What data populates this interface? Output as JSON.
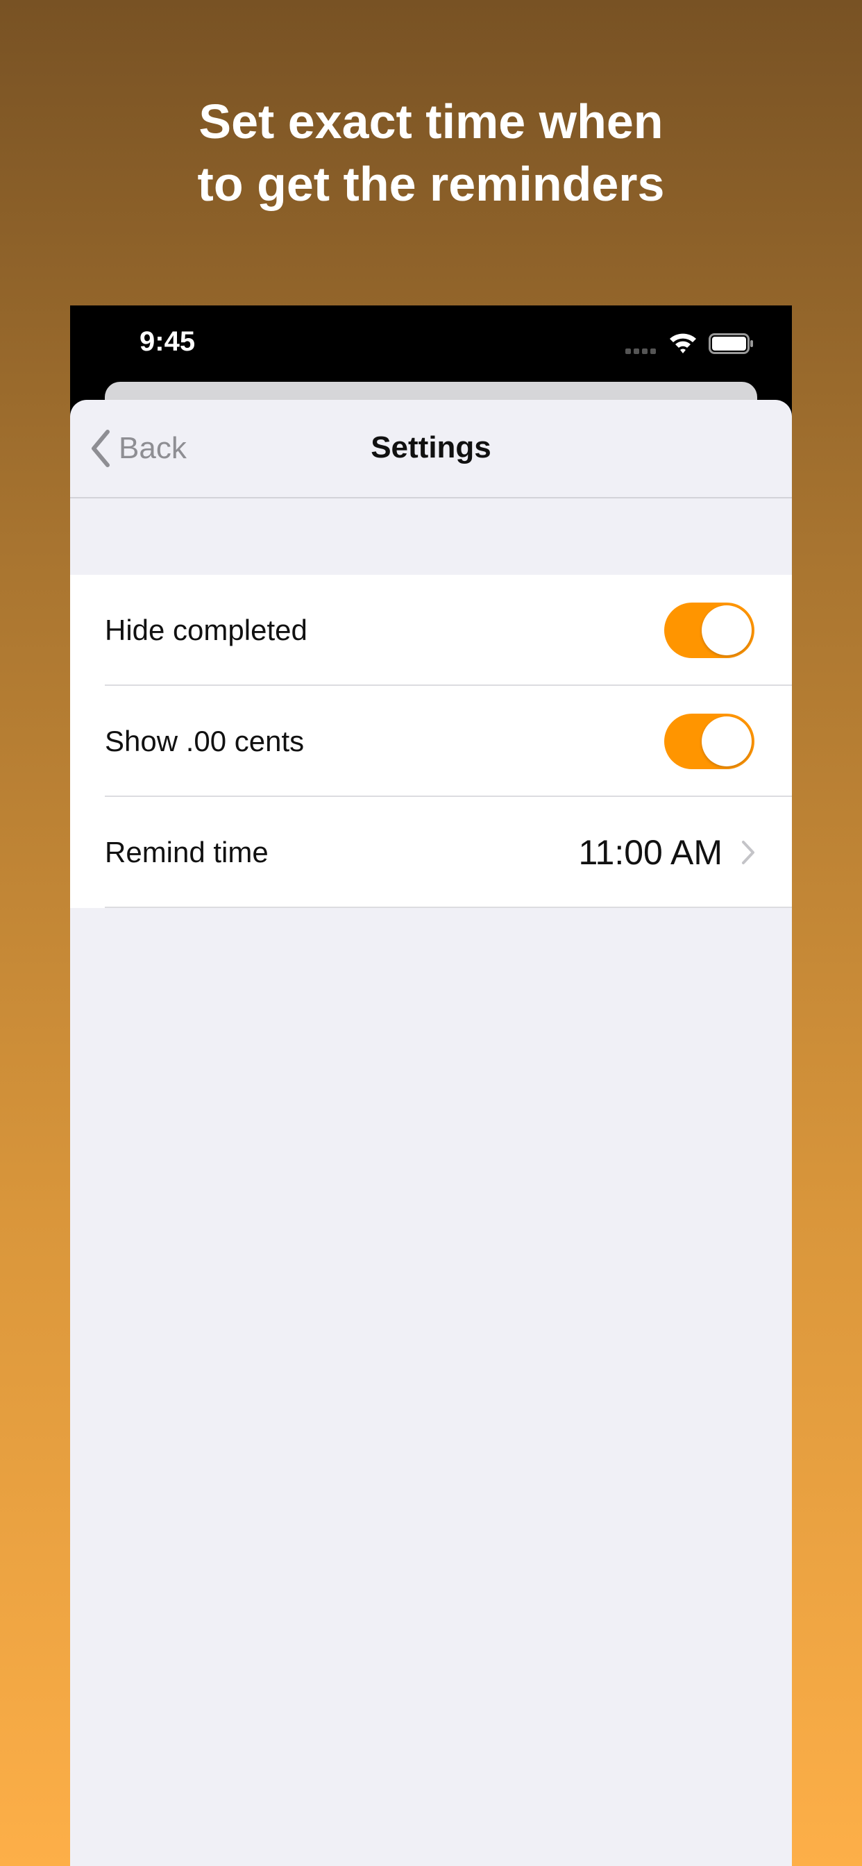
{
  "headline": {
    "line1": "Set exact time when",
    "line2": "to get the reminders"
  },
  "status_bar": {
    "time": "9:45",
    "icons": [
      "signal-icon",
      "wifi-icon",
      "battery-icon"
    ]
  },
  "navbar": {
    "back_label": "Back",
    "title": "Settings"
  },
  "settings": [
    {
      "label": "Hide completed",
      "type": "toggle",
      "on": true
    },
    {
      "label": "Show .00 cents",
      "type": "toggle",
      "on": true
    },
    {
      "label": "Remind time",
      "type": "disclosure",
      "value": "11:00 AM"
    }
  ],
  "colors": {
    "accent": "#ff9500",
    "gradient_top": "#785224",
    "gradient_bottom": "#fdaf48",
    "sheet_background": "#f0f0f6"
  }
}
